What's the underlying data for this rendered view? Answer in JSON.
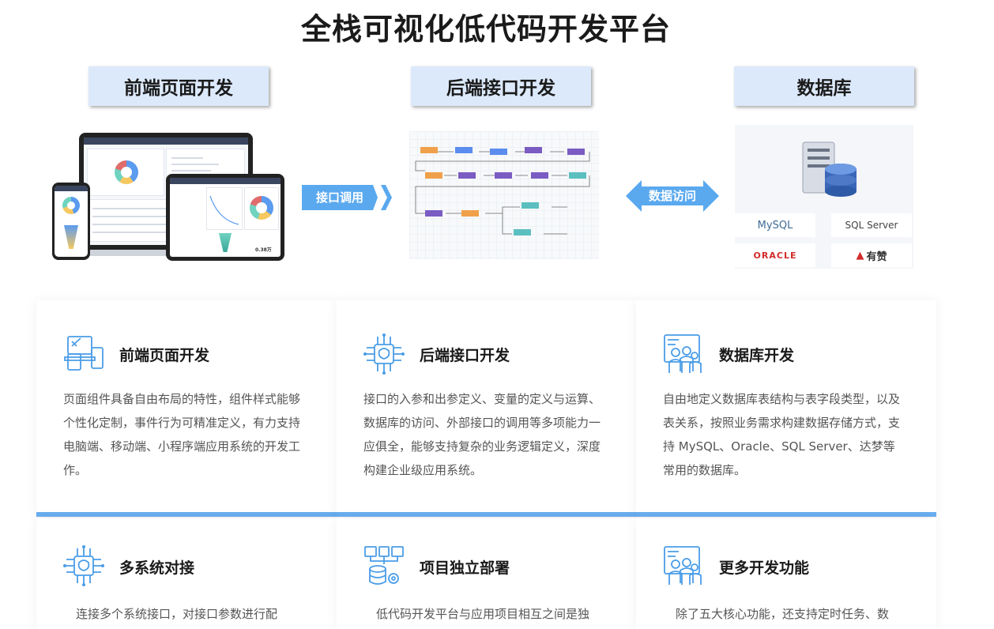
{
  "title": "全栈可视化低代码开发平台",
  "columns": [
    {
      "label": "前端页面开发"
    },
    {
      "label": "后端接口开发"
    },
    {
      "label": "数据库"
    }
  ],
  "arrows": {
    "api_call": "接口调用",
    "data_access": "数据访问"
  },
  "database_logos": [
    "MySQL",
    "SQL Server",
    "ORACLE",
    "有赞"
  ],
  "device_preview": {
    "amount": "0.38万"
  },
  "features": [
    {
      "title": "前端页面开发",
      "icon": "devices-icon",
      "body": "页面组件具备自由布局的特性，组件样式能够个性化定制，事件行为可精准定义，有力支持电脑端、移动端、小程序端应用系统的开发工作。"
    },
    {
      "title": "后端接口开发",
      "icon": "chip-brain-icon",
      "body": "接口的入参和出参定义、变量的定义与运算、数据库的访问、外部接口的调用等多项能力一应俱全，能够支持复杂的业务逻辑定义，深度构建企业级应用系统。"
    },
    {
      "title": "数据库开发",
      "icon": "team-screen-icon",
      "body": "自由地定义数据库表结构与表字段类型，以及表关系，按照业务需求构建数据存储方式，支持 MySQL、Oracle、SQL Server、达梦等常用的数据库。"
    },
    {
      "title": "多系统对接",
      "icon": "chip-brain-icon",
      "body": "连接多个系统接口，对接口参数进行配"
    },
    {
      "title": "项目独立部署",
      "icon": "deploy-icon",
      "body": "低代码开发平台与应用项目相互之间是独"
    },
    {
      "title": "更多开发功能",
      "icon": "team-screen-icon",
      "body": "除了五大核心功能，还支持定时任务、数"
    }
  ],
  "colors": {
    "accent": "#6aaef0",
    "header_bg": "#dce9fb",
    "arrow": "#5aa9ef",
    "icon": "#4a9de8"
  }
}
